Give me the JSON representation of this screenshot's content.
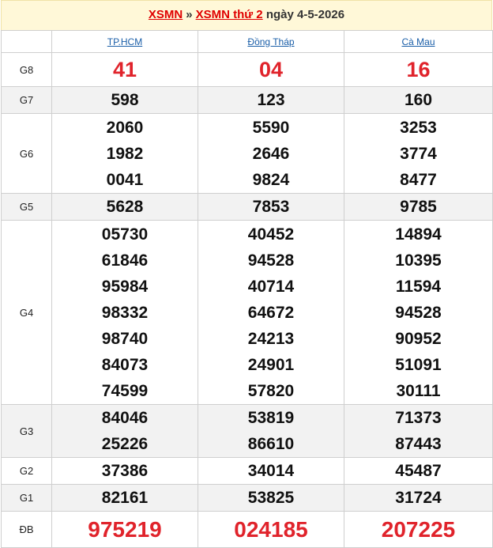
{
  "header": {
    "link1": "XSMN",
    "sep": "»",
    "link2": "XSMN thứ 2",
    "date": "ngày 4-5-2026"
  },
  "provinces": [
    "TP.HCM",
    "Đồng Tháp",
    "Cà Mau"
  ],
  "rows": [
    {
      "label": "G8",
      "values": [
        [
          "41"
        ],
        [
          "04"
        ],
        [
          "16"
        ]
      ]
    },
    {
      "label": "G7",
      "values": [
        [
          "598"
        ],
        [
          "123"
        ],
        [
          "160"
        ]
      ]
    },
    {
      "label": "G6",
      "values": [
        [
          "2060",
          "1982",
          "0041"
        ],
        [
          "5590",
          "2646",
          "9824"
        ],
        [
          "3253",
          "3774",
          "8477"
        ]
      ]
    },
    {
      "label": "G5",
      "values": [
        [
          "5628"
        ],
        [
          "7853"
        ],
        [
          "9785"
        ]
      ]
    },
    {
      "label": "G4",
      "values": [
        [
          "05730",
          "61846",
          "95984",
          "98332",
          "98740",
          "84073",
          "74599"
        ],
        [
          "40452",
          "94528",
          "40714",
          "64672",
          "24213",
          "24901",
          "57820"
        ],
        [
          "14894",
          "10395",
          "11594",
          "94528",
          "90952",
          "51091",
          "30111"
        ]
      ]
    },
    {
      "label": "G3",
      "values": [
        [
          "84046",
          "25226"
        ],
        [
          "53819",
          "86610"
        ],
        [
          "71373",
          "87443"
        ]
      ]
    },
    {
      "label": "G2",
      "values": [
        [
          "37386"
        ],
        [
          "34014"
        ],
        [
          "45487"
        ]
      ]
    },
    {
      "label": "G1",
      "values": [
        [
          "82161"
        ],
        [
          "53825"
        ],
        [
          "31724"
        ]
      ]
    },
    {
      "label": "ĐB",
      "values": [
        [
          "975219"
        ],
        [
          "024185"
        ],
        [
          "207225"
        ]
      ]
    }
  ]
}
